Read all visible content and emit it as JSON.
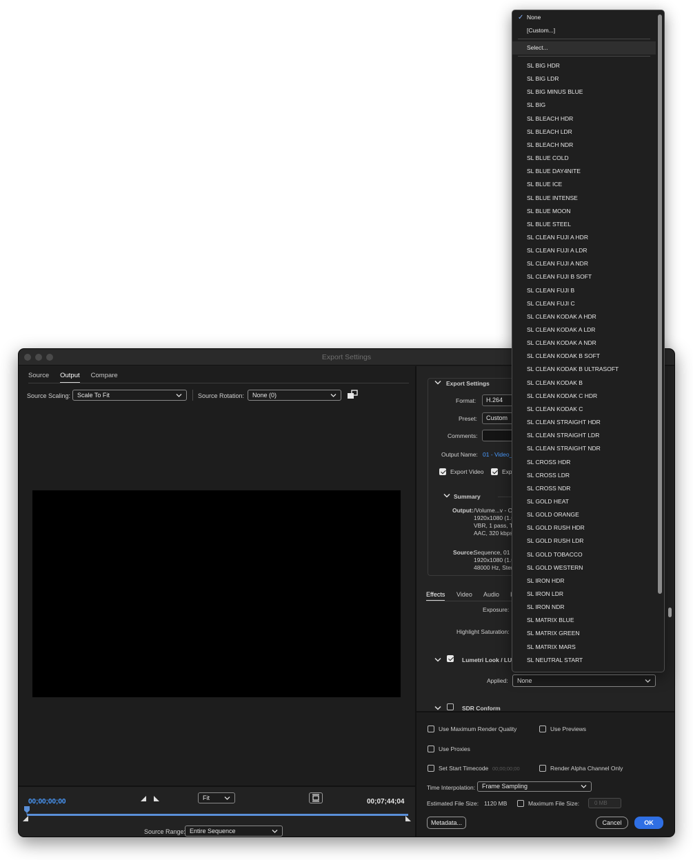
{
  "window": {
    "title": "Export Settings"
  },
  "left": {
    "tabs": [
      {
        "label": "Source"
      },
      {
        "label": "Output"
      },
      {
        "label": "Compare"
      }
    ],
    "source_scaling": {
      "label": "Source Scaling:",
      "value": "Scale To Fit"
    },
    "source_rotation": {
      "label": "Source Rotation:",
      "value": "None (0)"
    },
    "timecode_start": "00;00;00;00",
    "timecode_end": "00;07;44;04",
    "zoom": "Fit",
    "source_range": {
      "label": "Source Range:",
      "value": "Entire Sequence"
    },
    "accent_color": "#5a8fd8"
  },
  "export_settings": {
    "header": "Export Settings",
    "format_label": "Format:",
    "format_value": "H.264",
    "preset_label": "Preset:",
    "preset_value": "Custom",
    "comments_label": "Comments:",
    "comments_value": "",
    "output_name_label": "Output Name:",
    "output_name_value": "01 - Video_",
    "export_video_label": "Export Video",
    "export_audio_label": "Exp",
    "summary_header": "Summary",
    "output_label": "Output:",
    "output_lines": [
      "/Volume...v - OM",
      "1920x1080 (1.0)",
      "VBR, 1 pass, Tar",
      "AAC, 320 kbps,"
    ],
    "source_label": "Source:",
    "source_lines": [
      "Sequence, 01 - V",
      "1920x1080 (1.0)",
      "48000 Hz, Stere"
    ]
  },
  "effects": {
    "tabs": [
      {
        "label": "Effects"
      },
      {
        "label": "Video"
      },
      {
        "label": "Audio"
      },
      {
        "label": "I"
      }
    ],
    "exposure_label": "Exposure:",
    "highlight_saturation_label": "Highlight Saturation:",
    "lumetri_label": "Lumetri Look / LUT",
    "applied_label": "Applied:",
    "applied_value": "None",
    "sdr_label": "SDR Conform"
  },
  "bottom": {
    "max_render_quality": "Use Maximum Render Quality",
    "use_previews": "Use Previews",
    "use_proxies": "Use Proxies",
    "set_start_timecode": "Set Start Timecode",
    "start_timecode_value": "00;00;00;00",
    "render_alpha": "Render Alpha Channel Only",
    "time_interp_label": "Time Interpolation:",
    "time_interp_value": "Frame Sampling",
    "est_size_label": "Estimated File Size:",
    "est_size_value": "1120 MB",
    "max_file_size_label": "Maximum File Size:",
    "max_file_size_value": "0 MB",
    "metadata_button": "Metadata...",
    "cancel_button": "Cancel",
    "ok_button": "OK",
    "ok_color": "#2f6fe4"
  },
  "popup": {
    "checked": "None",
    "top_items": [
      {
        "label": "None"
      },
      {
        "label": "[Custom...]"
      }
    ],
    "select_item": "Select...",
    "luts": [
      "SL BIG HDR",
      "SL BIG LDR",
      "SL BIG MINUS BLUE",
      "SL BIG",
      "SL BLEACH HDR",
      "SL BLEACH LDR",
      "SL BLEACH NDR",
      "SL BLUE COLD",
      "SL BLUE DAY4NITE",
      "SL BLUE ICE",
      "SL BLUE INTENSE",
      "SL BLUE MOON",
      "SL BLUE STEEL",
      "SL CLEAN FUJI A HDR",
      "SL CLEAN FUJI A LDR",
      "SL CLEAN FUJI A NDR",
      "SL CLEAN FUJI B SOFT",
      "SL CLEAN FUJI B",
      "SL CLEAN FUJI C",
      "SL CLEAN KODAK A HDR",
      "SL CLEAN KODAK A LDR",
      "SL CLEAN KODAK A NDR",
      "SL CLEAN KODAK B SOFT",
      "SL CLEAN KODAK B ULTRASOFT",
      "SL CLEAN KODAK B",
      "SL CLEAN KODAK C HDR",
      "SL CLEAN KODAK C",
      "SL CLEAN STRAIGHT HDR",
      "SL CLEAN STRAIGHT LDR",
      "SL CLEAN STRAIGHT NDR",
      "SL CROSS HDR",
      "SL CROSS LDR",
      "SL CROSS NDR",
      "SL GOLD HEAT",
      "SL GOLD ORANGE",
      "SL GOLD RUSH HDR",
      "SL GOLD RUSH LDR",
      "SL GOLD TOBACCO",
      "SL GOLD WESTERN",
      "SL IRON HDR",
      "SL IRON LDR",
      "SL IRON NDR",
      "SL MATRIX BLUE",
      "SL MATRIX GREEN",
      "SL MATRIX MARS",
      "SL NEUTRAL START"
    ]
  }
}
